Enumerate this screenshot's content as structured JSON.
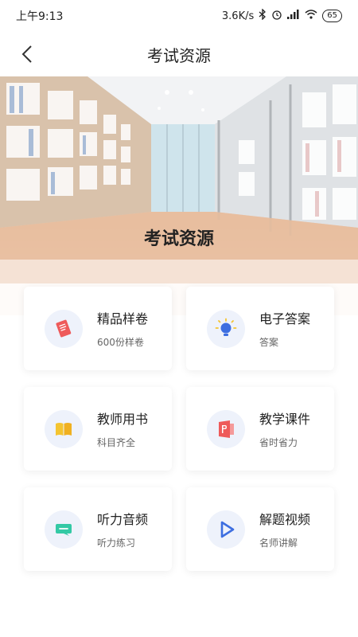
{
  "status_bar": {
    "time": "上午9:13",
    "speed": "3.6K/s",
    "battery": "65"
  },
  "nav": {
    "title": "考试资源"
  },
  "banner": {
    "title": "考试资源"
  },
  "cards": [
    {
      "title": "精品样卷",
      "subtitle": "600份样卷",
      "icon": "sample-paper-icon"
    },
    {
      "title": "电子答案",
      "subtitle": "答案",
      "icon": "lightbulb-icon"
    },
    {
      "title": "教师用书",
      "subtitle": "科目齐全",
      "icon": "book-icon"
    },
    {
      "title": "教学课件",
      "subtitle": "省时省力",
      "icon": "presentation-icon"
    },
    {
      "title": "听力音频",
      "subtitle": "听力练习",
      "icon": "chat-bubble-icon"
    },
    {
      "title": "解题视频",
      "subtitle": "名师讲解",
      "icon": "play-icon"
    }
  ],
  "colors": {
    "accent_blue": "#3d6ee0",
    "red": "#ee5a5a",
    "yellow": "#f4c430",
    "teal": "#33c9a5",
    "icon_bg": "#eef2fb"
  }
}
